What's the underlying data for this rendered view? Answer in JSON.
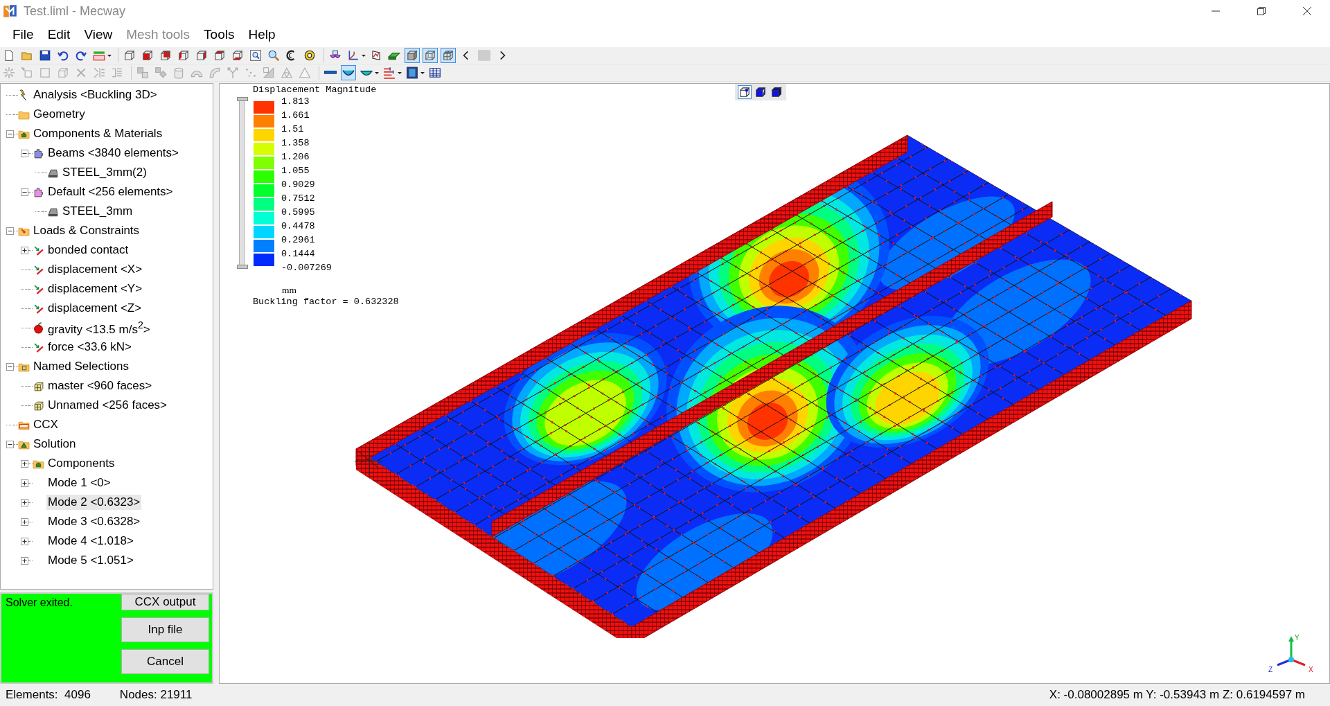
{
  "window": {
    "title": "Test.liml - Mecway"
  },
  "menu": [
    {
      "label": "File",
      "disabled": false
    },
    {
      "label": "Edit",
      "disabled": false
    },
    {
      "label": "View",
      "disabled": false
    },
    {
      "label": "Mesh tools",
      "disabled": true
    },
    {
      "label": "Tools",
      "disabled": false
    },
    {
      "label": "Help",
      "disabled": false
    }
  ],
  "toolbar_rows": [
    [
      [
        {
          "kind": "new",
          "disabled": false,
          "pressed": false
        },
        {
          "kind": "open",
          "disabled": false,
          "pressed": false
        },
        {
          "kind": "save",
          "disabled": false,
          "pressed": false
        },
        {
          "kind": "undo",
          "disabled": false,
          "pressed": false
        },
        {
          "kind": "redo",
          "disabled": false,
          "pressed": false
        },
        {
          "kind": "solve",
          "disabled": false,
          "pressed": false
        }
      ],
      [
        {
          "kind": "cube",
          "disabled": false,
          "pressed": false
        },
        {
          "kind": "red-front",
          "disabled": false,
          "pressed": false
        },
        {
          "kind": "red-back",
          "disabled": false,
          "pressed": false
        },
        {
          "kind": "red-left",
          "disabled": false,
          "pressed": false
        },
        {
          "kind": "red-right",
          "disabled": false,
          "pressed": false
        },
        {
          "kind": "red-top",
          "disabled": false,
          "pressed": false
        },
        {
          "kind": "red-bottom",
          "disabled": false,
          "pressed": false
        },
        {
          "kind": "zoom-window",
          "disabled": false,
          "pressed": false
        },
        {
          "kind": "zoom",
          "disabled": false,
          "pressed": false
        },
        {
          "kind": "rotate",
          "disabled": false,
          "pressed": false
        },
        {
          "kind": "zoom-fit",
          "disabled": false,
          "pressed": false
        }
      ],
      [
        {
          "kind": "glasses",
          "disabled": false,
          "pressed": false
        },
        {
          "kind": "axes",
          "disabled": false,
          "pressed": false
        },
        {
          "kind": "graph",
          "disabled": false,
          "pressed": false
        },
        {
          "kind": "plate",
          "disabled": false,
          "pressed": false
        },
        {
          "kind": "shaded",
          "disabled": false,
          "pressed": true
        },
        {
          "kind": "wireframe",
          "disabled": false,
          "pressed": true
        },
        {
          "kind": "mesh",
          "disabled": false,
          "pressed": true
        },
        {
          "kind": "scroll-left",
          "disabled": false,
          "pressed": false
        },
        {
          "kind": "scroll-thumb",
          "disabled": false,
          "pressed": false
        },
        {
          "kind": "scroll-right",
          "disabled": false,
          "pressed": false
        }
      ]
    ],
    [
      [
        {
          "kind": "nodes",
          "disabled": true,
          "pressed": false
        },
        {
          "kind": "node-box",
          "disabled": true,
          "pressed": false
        },
        {
          "kind": "square",
          "disabled": true,
          "pressed": false
        },
        {
          "kind": "cube",
          "disabled": true,
          "pressed": false
        },
        {
          "kind": "delete",
          "disabled": true,
          "pressed": false
        },
        {
          "kind": "split",
          "disabled": true,
          "pressed": false
        },
        {
          "kind": "list",
          "disabled": true,
          "pressed": false
        }
      ],
      [
        {
          "kind": "merge",
          "disabled": true,
          "pressed": false
        },
        {
          "kind": "move",
          "disabled": true,
          "pressed": false
        },
        {
          "kind": "cylinder",
          "disabled": true,
          "pressed": false
        },
        {
          "kind": "arch",
          "disabled": true,
          "pressed": false
        },
        {
          "kind": "sweep",
          "disabled": true,
          "pressed": false
        },
        {
          "kind": "branch",
          "disabled": true,
          "pressed": false
        },
        {
          "kind": "dots",
          "disabled": true,
          "pressed": false
        },
        {
          "kind": "scale",
          "disabled": true,
          "pressed": false
        },
        {
          "kind": "tri-mesh",
          "disabled": true,
          "pressed": false
        },
        {
          "kind": "triangle",
          "disabled": true,
          "pressed": false
        }
      ],
      [
        {
          "kind": "line",
          "disabled": false,
          "pressed": false
        },
        {
          "kind": "bowl",
          "disabled": false,
          "pressed": true
        },
        {
          "kind": "bowl-menu",
          "disabled": false,
          "pressed": false
        },
        {
          "kind": "bars",
          "disabled": false,
          "pressed": false
        },
        {
          "kind": "film",
          "disabled": false,
          "pressed": false
        },
        {
          "kind": "table",
          "disabled": false,
          "pressed": false
        }
      ]
    ]
  ],
  "tree": [
    {
      "label": "Analysis <Buckling 3D>",
      "kind": "lightning",
      "selected": false
    },
    {
      "label": "Geometry",
      "kind": "folder",
      "selected": false
    },
    {
      "label": "Components & Materials",
      "kind": "component-folder",
      "selected": false,
      "expanded": true,
      "children": [
        {
          "label": "Beams <3840 elements>",
          "kind": "component",
          "color": "#8c8ce8",
          "selected": false,
          "expanded": true,
          "children": [
            {
              "label": "STEEL_3mm(2)",
              "kind": "material",
              "selected": false
            }
          ]
        },
        {
          "label": "Default <256 elements>",
          "kind": "component",
          "color": "#e890e8",
          "selected": false,
          "expanded": true,
          "children": [
            {
              "label": "STEEL_3mm",
              "kind": "material",
              "selected": false
            }
          ]
        }
      ]
    },
    {
      "label": "Loads & Constraints",
      "kind": "loads-folder",
      "selected": false,
      "expanded": true,
      "children": [
        {
          "label": "bonded contact",
          "kind": "constraint",
          "selected": false,
          "expanded": false
        },
        {
          "label": "displacement <X>",
          "kind": "constraint",
          "selected": false
        },
        {
          "label": "displacement <Y>",
          "kind": "constraint",
          "selected": false
        },
        {
          "label": "displacement <Z>",
          "kind": "constraint",
          "selected": false
        },
        {
          "label": "gravity <13.5 m/s$^{2}$>",
          "kind": "apple",
          "selected": false
        },
        {
          "label": "force <33.6 kN>",
          "kind": "constraint",
          "selected": false
        }
      ]
    },
    {
      "label": "Named Selections",
      "kind": "selection-folder",
      "selected": false,
      "expanded": true,
      "children": [
        {
          "label": "master <960 faces>",
          "kind": "selection",
          "selected": false
        },
        {
          "label": "Unnamed <256 faces>",
          "kind": "selection",
          "selected": false
        }
      ]
    },
    {
      "label": "CCX",
      "kind": "ccx",
      "selected": false
    },
    {
      "label": "Solution",
      "kind": "solution-folder",
      "selected": false,
      "expanded": true,
      "children": [
        {
          "label": "Components",
          "kind": "component-folder",
          "selected": false,
          "expanded": false
        },
        {
          "label": "Mode 1 <0>",
          "kind": "mode",
          "selected": false,
          "expanded": false
        },
        {
          "label": "Mode 2 <0.6323>",
          "kind": "mode",
          "selected": true,
          "expanded": false
        },
        {
          "label": "Mode 3 <0.6328>",
          "kind": "mode",
          "selected": false,
          "expanded": false
        },
        {
          "label": "Mode 4 <1.018>",
          "kind": "mode",
          "selected": false,
          "expanded": false
        },
        {
          "label": "Mode 5 <1.051>",
          "kind": "mode",
          "selected": false,
          "expanded": false
        }
      ]
    }
  ],
  "solver_panel": {
    "message": "Solver exited.",
    "buttons": [
      "CCX output",
      "Inp file",
      "Cancel"
    ]
  },
  "viewport": {
    "view_buttons": [
      {
        "kind": "vertex",
        "selected": true
      },
      {
        "kind": "face",
        "selected": false
      },
      {
        "kind": "solid",
        "selected": false
      }
    ],
    "legend": {
      "title": "Displacement Magnitude",
      "range_slider": {
        "level": 1
      },
      "bands": [
        {
          "color": "#ff3300"
        },
        {
          "color": "#ff8000"
        },
        {
          "color": "#ffd500"
        },
        {
          "color": "#d5ff00"
        },
        {
          "color": "#80ff00"
        },
        {
          "color": "#2bff00"
        },
        {
          "color": "#00ff2b"
        },
        {
          "color": "#00ff80"
        },
        {
          "color": "#00ffd5"
        },
        {
          "color": "#00d5ff"
        },
        {
          "color": "#0080ff"
        },
        {
          "color": "#002bff"
        }
      ],
      "ticks": [
        "1.813",
        "1.661",
        "1.51",
        "1.358",
        "1.206",
        "1.055",
        "0.9029",
        "0.7512",
        "0.5995",
        "0.4478",
        "0.2961",
        "0.1444",
        "-0.007269"
      ],
      "unit": "mm"
    },
    "buckling_factor": "Buckling factor = 0.632328",
    "axis_labels": {
      "x": "X",
      "y": "Y",
      "z": "Z"
    }
  },
  "status_bar": {
    "elements": "Elements:  4096",
    "nodes": "Nodes: 21911",
    "coordinates": "X: -0.08002895 m Y: -0.53943 m Z: 0.6194597 m"
  }
}
